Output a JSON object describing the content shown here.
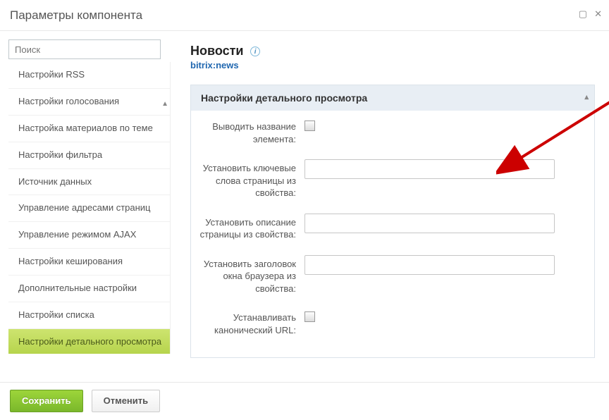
{
  "dialog": {
    "title": "Параметры компонента"
  },
  "search": {
    "placeholder": "Поиск"
  },
  "sidebar": {
    "items": [
      {
        "label": "Настройки RSS"
      },
      {
        "label": "Настройки голосования"
      },
      {
        "label": "Настройка материалов по теме"
      },
      {
        "label": "Настройки фильтра"
      },
      {
        "label": "Источник данных"
      },
      {
        "label": "Управление адресами страниц"
      },
      {
        "label": "Управление режимом AJAX"
      },
      {
        "label": "Настройки кеширования"
      },
      {
        "label": "Дополнительные настройки"
      },
      {
        "label": "Настройки списка"
      },
      {
        "label": "Настройки детального просмотра"
      }
    ]
  },
  "content": {
    "title": "Новости",
    "component": "bitrix:news",
    "section_title": "Настройки детального просмотра",
    "fields": [
      {
        "label": "Выводить название элемента:",
        "type": "checkbox"
      },
      {
        "label": "Установить ключевые слова страницы из свойства:",
        "type": "text"
      },
      {
        "label": "Установить описание страницы из свойства:",
        "type": "text"
      },
      {
        "label": "Установить заголовок окна браузера из свойства:",
        "type": "text"
      },
      {
        "label": "Устанавливать канонический URL:",
        "type": "checkbox"
      }
    ]
  },
  "footer": {
    "save": "Сохранить",
    "cancel": "Отменить"
  }
}
